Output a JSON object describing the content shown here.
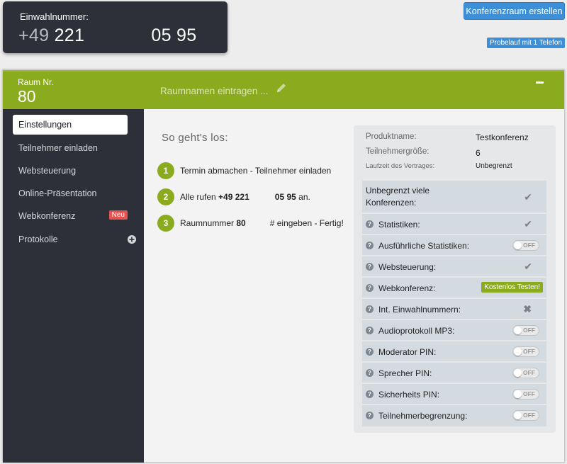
{
  "dialin": {
    "label": "Einwahlnummer:",
    "country": "+49",
    "area": "221",
    "tail": "05 95"
  },
  "actions": {
    "create_room": "Konferenzraum erstellen",
    "trial": "Probelauf mit 1 Telefon"
  },
  "room": {
    "label": "Raum Nr.",
    "number": "80",
    "name_placeholder": "Raumnamen eintragen ..."
  },
  "sidebar": {
    "items": [
      {
        "label": "Einstellungen"
      },
      {
        "label": "Teilnehmer einladen"
      },
      {
        "label": "Websteuerung"
      },
      {
        "label": "Online-Präsentation"
      },
      {
        "label": "Webkonferenz",
        "badge": "Neu"
      },
      {
        "label": "Protokolle"
      }
    ]
  },
  "intro": {
    "title": "So geht's los:",
    "steps": [
      {
        "num": "1",
        "text": "Termin abmachen - Teilnehmer einladen"
      },
      {
        "num": "2",
        "pre": "Alle rufen",
        "bold1": "+49 221",
        "bold2": "05 95",
        "post": "an."
      },
      {
        "num": "3",
        "pre": "Raumnummer",
        "bold1": "80",
        "post": "# eingeben - Fertig!"
      }
    ]
  },
  "product": {
    "rows": [
      {
        "key": "Produktname:",
        "value": "Testkonferenz"
      },
      {
        "key": "Teilnehmergröße:",
        "value": "6"
      },
      {
        "key": "Laufzeit des Vertrages:",
        "value": "Unbegrenzt"
      }
    ],
    "features": [
      {
        "label": "Unbegrenzt viele Konferenzen:",
        "line1": "Unbegrenzt viele",
        "line2": "Konferenzen:",
        "state": "check"
      },
      {
        "label": "Statistiken:",
        "state": "check"
      },
      {
        "label": "Ausführliche Statistiken:",
        "state": "toggle"
      },
      {
        "label": "Websteuerung:",
        "state": "check"
      },
      {
        "label": "Webkonferenz:",
        "state": "button",
        "button": "Kostenlos Testen!"
      },
      {
        "label": "Int. Einwahlnummern:",
        "state": "x"
      },
      {
        "label": "Audioprotokoll MP3:",
        "state": "toggle"
      },
      {
        "label": "Moderator PIN:",
        "state": "toggle"
      },
      {
        "label": "Sprecher PIN:",
        "state": "toggle"
      },
      {
        "label": "Sicherheits PIN:",
        "state": "toggle"
      },
      {
        "label": "Teilnehmerbegrenzung:",
        "state": "toggle"
      }
    ],
    "toggle_text": "OFF"
  },
  "colors": {
    "brand_green": "#8bab1f",
    "sidebar_dark": "#2d3038",
    "button_blue": "#3d8fd8",
    "badge_red": "#e9534f"
  }
}
